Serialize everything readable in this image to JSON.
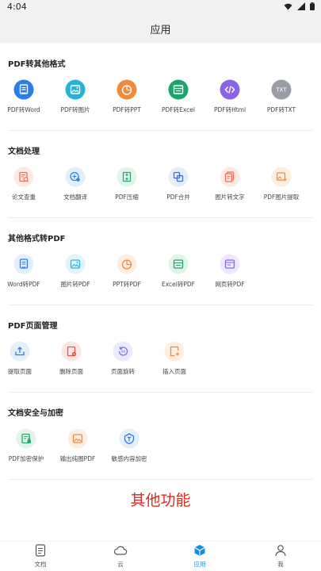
{
  "status_bar": {
    "time": "4:04"
  },
  "header": {
    "title": "应用"
  },
  "sections": [
    {
      "title": "PDF转其他格式",
      "items": [
        {
          "label": "PDF转Word",
          "icon": "pdf-to-word-icon",
          "color": "#2b7de9"
        },
        {
          "label": "PDF转图片",
          "icon": "pdf-to-image-icon",
          "color": "#27b3d9"
        },
        {
          "label": "PDF转PPT",
          "icon": "pdf-to-ppt-icon",
          "color": "#f08a3c"
        },
        {
          "label": "PDF转Excel",
          "icon": "pdf-to-excel-icon",
          "color": "#1aa66a"
        },
        {
          "label": "PDF转Html",
          "icon": "pdf-to-html-icon",
          "color": "#8d63e6"
        },
        {
          "label": "PDF转TXT",
          "icon": "pdf-to-txt-icon",
          "color": "#9a9ca6"
        }
      ]
    },
    {
      "title": "文档处理",
      "items": [
        {
          "label": "论文查重",
          "icon": "plagiarism-check-icon",
          "color": "#f0705a"
        },
        {
          "label": "文档翻译",
          "icon": "document-translate-icon",
          "color": "#2a86d8"
        },
        {
          "label": "PDF压缩",
          "icon": "pdf-compress-icon",
          "color": "#21a86c"
        },
        {
          "label": "PDF合并",
          "icon": "pdf-merge-icon",
          "color": "#3b6fe0"
        },
        {
          "label": "图片转文字",
          "icon": "image-to-text-icon",
          "color": "#f0705a"
        },
        {
          "label": "PDF图片提取",
          "icon": "pdf-image-extract-icon",
          "color": "#f08a3c"
        }
      ]
    },
    {
      "title": "其他格式转PDF",
      "items": [
        {
          "label": "Word转PDF",
          "icon": "word-to-pdf-icon",
          "color": "#2b7de9"
        },
        {
          "label": "图片转PDF",
          "icon": "image-to-pdf-icon",
          "color": "#27b3d9"
        },
        {
          "label": "PPT转PDF",
          "icon": "ppt-to-pdf-icon",
          "color": "#f08a3c"
        },
        {
          "label": "Excel转PDF",
          "icon": "excel-to-pdf-icon",
          "color": "#1aa66a"
        },
        {
          "label": "网页转PDF",
          "icon": "webpage-to-pdf-icon",
          "color": "#8d63e6"
        }
      ]
    },
    {
      "title": "PDF页面管理",
      "items": [
        {
          "label": "提取页面",
          "icon": "extract-page-icon",
          "color": "#2b7de9"
        },
        {
          "label": "删除页面",
          "icon": "delete-page-icon",
          "color": "#e8534a"
        },
        {
          "label": "页面旋转",
          "icon": "rotate-page-icon",
          "color": "#7b6fe6"
        },
        {
          "label": "插入页面",
          "icon": "insert-page-icon",
          "color": "#f08a3c"
        }
      ]
    },
    {
      "title": "文档安全与加密",
      "items": [
        {
          "label": "PDF加密保护",
          "icon": "pdf-encrypt-icon",
          "color": "#21a86c"
        },
        {
          "label": "输出纯图PDF",
          "icon": "export-image-pdf-icon",
          "color": "#f08a3c"
        },
        {
          "label": "敏感内容加密",
          "icon": "sensitive-content-encrypt-icon",
          "color": "#2b7de9"
        }
      ]
    }
  ],
  "footer_text": "其他功能",
  "bottom_nav": [
    {
      "label": "文档",
      "icon": "document-icon",
      "active": false
    },
    {
      "label": "云",
      "icon": "cloud-icon",
      "active": false
    },
    {
      "label": "应用",
      "icon": "apps-cube-icon",
      "active": true
    },
    {
      "label": "我",
      "icon": "profile-icon",
      "active": false
    }
  ],
  "colors": {
    "accent": "#1a8fe0",
    "footer_text": "#e0291f"
  }
}
